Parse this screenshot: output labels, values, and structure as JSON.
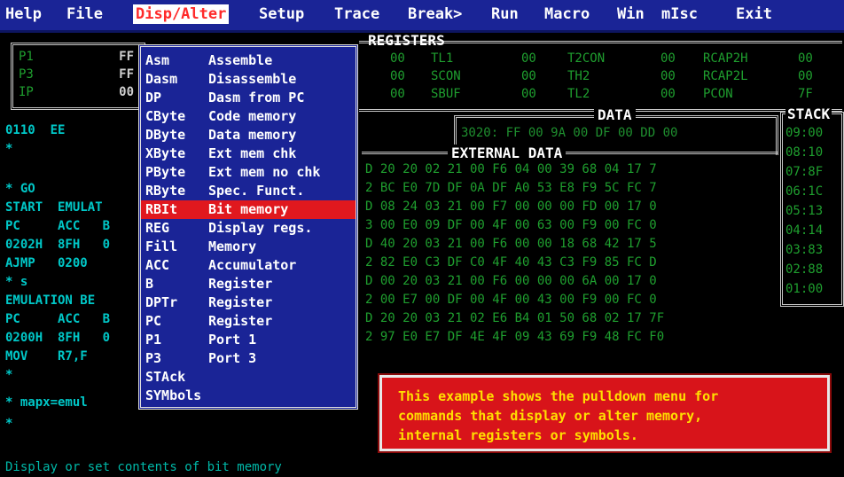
{
  "menubar": {
    "items": [
      "Help",
      "File",
      "Disp/Alter",
      "Setup",
      "Trace",
      "Break>",
      "Run",
      "Macro",
      "Win",
      "mIsc",
      "Exit"
    ],
    "active": "Disp/Alter"
  },
  "left_registers": [
    {
      "label": "P1",
      "value": "FF"
    },
    {
      "label": "P3",
      "value": "FF"
    },
    {
      "label": "IP",
      "value": "00"
    }
  ],
  "trace_lines": [
    "0110  EE",
    "*",
    "",
    "* GO",
    "START  EMULAT",
    "PC     ACC   B",
    "0202H  8FH   0",
    "AJMP   0200",
    "* s",
    "EMULATION BE",
    "PC     ACC   B",
    "0200H  8FH   0",
    "MOV    R7,F",
    "*",
    "* mapx=emul",
    "*"
  ],
  "registers_title": "REGISTERS",
  "registers": [
    {
      "label": "TL1",
      "value": "00"
    },
    {
      "label": "T2CON",
      "value": "00"
    },
    {
      "label": "RCAP2H",
      "value": "00"
    },
    {
      "label": "SCON",
      "value": "00"
    },
    {
      "label": "TH2",
      "value": "00"
    },
    {
      "label": "RCAP2L",
      "value": "00"
    },
    {
      "label": "SBUF",
      "value": "00"
    },
    {
      "label": "TL2",
      "value": "00"
    },
    {
      "label": "PCON",
      "value": "7F"
    }
  ],
  "registers_left_values": [
    "00",
    "00",
    "00"
  ],
  "data_title": "DATA",
  "data_line": "3020: FF 00 9A 00 DF 00 DD 00",
  "external_title": "EXTERNAL DATA",
  "external_rows": [
    "D 20 20 02 21 00 F6 04 00 39 68 04 17 7",
    "2 BC E0 7D DF 0A DF A0 53 E8 F9 5C FC 7",
    "D 08 24 03 21 00 F7 00 00 00 FD 00 17 0",
    "3 00 E0 09 DF 00 4F 00 63 00 F9 00 FC 0",
    "D 40 20 03 21 00 F6 00 00 18 68 42 17 5",
    "2 82 E0 C3 DF C0 4F 40 43 C3 F9 85 FC D",
    "D 00 20 03 21 00 F6 00 00 00 6A 00 17 0",
    "2 00 E7 00 DF 00 4F 00 43 00 F9 00 FC 0",
    "D 20 20 03 21 02 E6 B4 01 50 68 02 17 7F",
    "2 97 E0 E7 DF 4E 4F 09 43 69 F9 48 FC F0"
  ],
  "stack_title": "STACK",
  "stack_rows": [
    "09:00",
    "08:10",
    "07:8F",
    "06:1C",
    "05:13",
    "04:14",
    "03:83",
    "02:88",
    "01:00"
  ],
  "menu_items": [
    {
      "key": "Asm",
      "desc": "Assemble"
    },
    {
      "key": "Dasm",
      "desc": "Disassemble"
    },
    {
      "key": "DP",
      "desc": "Dasm from PC"
    },
    {
      "key": "CByte",
      "desc": "Code memory"
    },
    {
      "key": "DByte",
      "desc": "Data memory"
    },
    {
      "key": "XByte",
      "desc": "Ext mem chk"
    },
    {
      "key": "PByte",
      "desc": "Ext mem no chk"
    },
    {
      "key": "RByte",
      "desc": "Spec. Funct."
    },
    {
      "key": "RBIt",
      "desc": "Bit memory"
    },
    {
      "key": "REG",
      "desc": "Display regs."
    },
    {
      "key": "Fill",
      "desc": "Memory"
    },
    {
      "key": "ACC",
      "desc": "Accumulator"
    },
    {
      "key": "B",
      "desc": "Register"
    },
    {
      "key": "DPTr",
      "desc": "Register"
    },
    {
      "key": "PC",
      "desc": "Register"
    },
    {
      "key": "P1",
      "desc": "Port 1"
    },
    {
      "key": "P3",
      "desc": "Port 3"
    },
    {
      "key": "STAck",
      "desc": ""
    },
    {
      "key": "SYMbols",
      "desc": ""
    }
  ],
  "menu_selected": "RBIt",
  "callout_lines": [
    "This example shows the pulldown menu for",
    "commands that display or alter memory,",
    "internal registers or symbols."
  ],
  "status_text": "Display or set contents of bit memory",
  "colors": {
    "menubar_bg": "#1a2496",
    "menu_bg": "#1a2496",
    "selected_bg": "#e0181e",
    "callout_bg": "#d8141a",
    "callout_text": "#ffe000",
    "data_green": "#1f9f2f",
    "trace_cyan": "#00c8c8"
  }
}
